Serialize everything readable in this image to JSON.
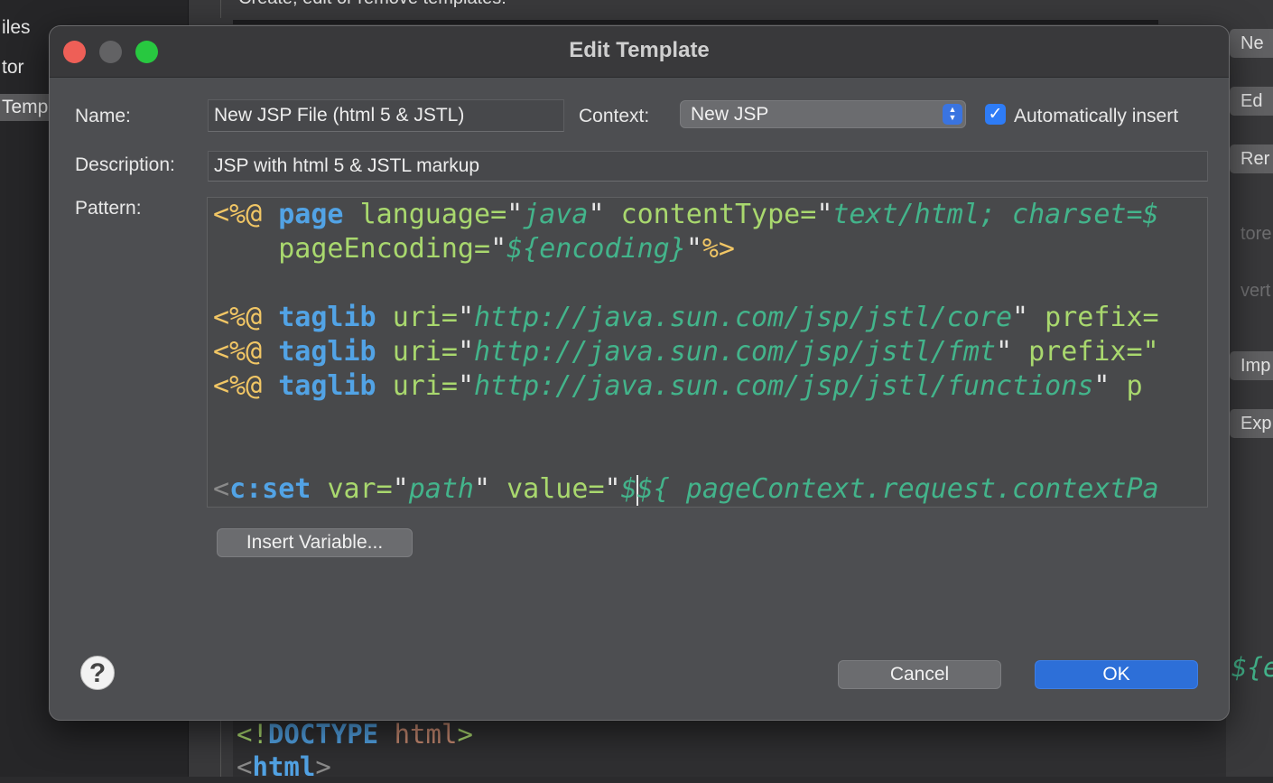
{
  "background": {
    "sidebar_items": [
      "iles",
      "tor",
      "Templ"
    ],
    "description_text": "Create, edit or remove templates:",
    "right_buttons": [
      "Ne",
      "Ed",
      "Rer",
      "tore",
      "vert t",
      "Imp",
      "Exp"
    ],
    "right_code_snippet": "${e",
    "code_lines": {
      "doctype_lt": "<!",
      "doctype_kw": "DOCTYPE",
      "doctype_rest": " html",
      "doctype_gt": ">",
      "html_lt": "<",
      "html_kw": "html",
      "html_gt": ">"
    }
  },
  "dialog": {
    "title": "Edit Template",
    "name_label": "Name:",
    "name_value": "New JSP File (html 5 & JSTL)",
    "context_label": "Context:",
    "context_value": "New JSP",
    "auto_insert_label": "Automatically insert",
    "auto_insert_checked": true,
    "description_label": "Description:",
    "description_value": "JSP with html 5 & JSTL markup",
    "pattern_label": "Pattern:",
    "pattern_code": {
      "dir_open": "<%@",
      "dir_close": "%>",
      "line1": {
        "kw": "page",
        "attr1": "language",
        "val1": "java",
        "attr2": "contentType",
        "val2": "text/html; charset=$"
      },
      "line2": {
        "attr": "pageEncoding",
        "val": "${encoding}"
      },
      "taglibs": [
        {
          "kw": "taglib",
          "attr": "uri",
          "val": "http://java.sun.com/jsp/jstl/core",
          "tail": "prefix="
        },
        {
          "kw": "taglib",
          "attr": "uri",
          "val": "http://java.sun.com/jsp/jstl/fmt",
          "tail": "prefix=\""
        },
        {
          "kw": "taglib",
          "attr": "uri",
          "val": "http://java.sun.com/jsp/jstl/functions",
          "tail": "p"
        }
      ],
      "cset": {
        "lt": "<",
        "tag": "c:set",
        "attr1": "var",
        "val1": "path",
        "attr2": "value",
        "val2_pre": "$",
        "val2_post": "${ pageContext.request.contextPa"
      }
    },
    "insert_variable_label": "Insert Variable...",
    "help_symbol": "?",
    "cancel_label": "Cancel",
    "ok_label": "OK"
  },
  "colors": {
    "accent": "#2d6fd8",
    "directive": "#f1c665",
    "keyword": "#52a3e5",
    "attribute": "#a9d86e",
    "value": "#43b48b",
    "close_button": "#ee5f57",
    "zoom_button": "#28c840"
  },
  "icons": [
    "close-window-icon",
    "minimize-window-icon",
    "zoom-window-icon",
    "select-arrows-icon",
    "checkmark-icon",
    "help-icon"
  ]
}
